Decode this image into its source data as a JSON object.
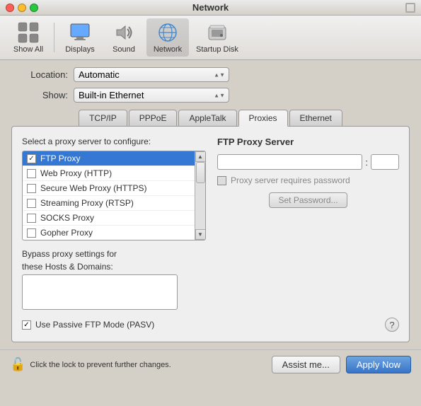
{
  "window": {
    "title": "Network"
  },
  "toolbar": {
    "items": [
      {
        "id": "show-all",
        "label": "Show All",
        "icon": "🍎"
      },
      {
        "id": "displays",
        "label": "Displays",
        "icon": "🖥"
      },
      {
        "id": "sound",
        "label": "Sound",
        "icon": "🔊"
      },
      {
        "id": "network",
        "label": "Network",
        "icon": "🌐",
        "active": true
      },
      {
        "id": "startup-disk",
        "label": "Startup Disk",
        "icon": "💾"
      }
    ]
  },
  "form": {
    "location_label": "Location:",
    "location_value": "Automatic",
    "show_label": "Show:",
    "show_value": "Built-in Ethernet"
  },
  "tabs": [
    {
      "id": "tcpip",
      "label": "TCP/IP"
    },
    {
      "id": "pppoe",
      "label": "PPPoE"
    },
    {
      "id": "appletalk",
      "label": "AppleTalk"
    },
    {
      "id": "proxies",
      "label": "Proxies",
      "active": true
    },
    {
      "id": "ethernet",
      "label": "Ethernet"
    }
  ],
  "panel": {
    "proxy_list_title": "Select a proxy server to configure:",
    "proxies": [
      {
        "id": "ftp",
        "label": "FTP Proxy",
        "checked": true,
        "selected": true
      },
      {
        "id": "web",
        "label": "Web Proxy (HTTP)",
        "checked": false,
        "selected": false
      },
      {
        "id": "secure-web",
        "label": "Secure Web Proxy (HTTPS)",
        "checked": false,
        "selected": false
      },
      {
        "id": "streaming",
        "label": "Streaming Proxy (RTSP)",
        "checked": false,
        "selected": false
      },
      {
        "id": "socks",
        "label": "SOCKS Proxy",
        "checked": false,
        "selected": false
      },
      {
        "id": "gopher",
        "label": "Gopher Proxy",
        "checked": false,
        "selected": false
      }
    ],
    "ftp_section": {
      "title": "FTP Proxy Server",
      "server_value": "",
      "port_value": "",
      "requires_password_label": "Proxy server requires password",
      "set_password_label": "Set Password..."
    },
    "bypass": {
      "line1": "Bypass proxy settings for",
      "line2": "these Hosts & Domains:",
      "value": ""
    },
    "passive": {
      "label": "Use Passive FTP Mode (PASV)",
      "checked": true
    },
    "help": "?"
  },
  "bottom_bar": {
    "lock_text": "Click the lock to prevent further changes.",
    "assist_label": "Assist me...",
    "apply_label": "Apply Now"
  }
}
